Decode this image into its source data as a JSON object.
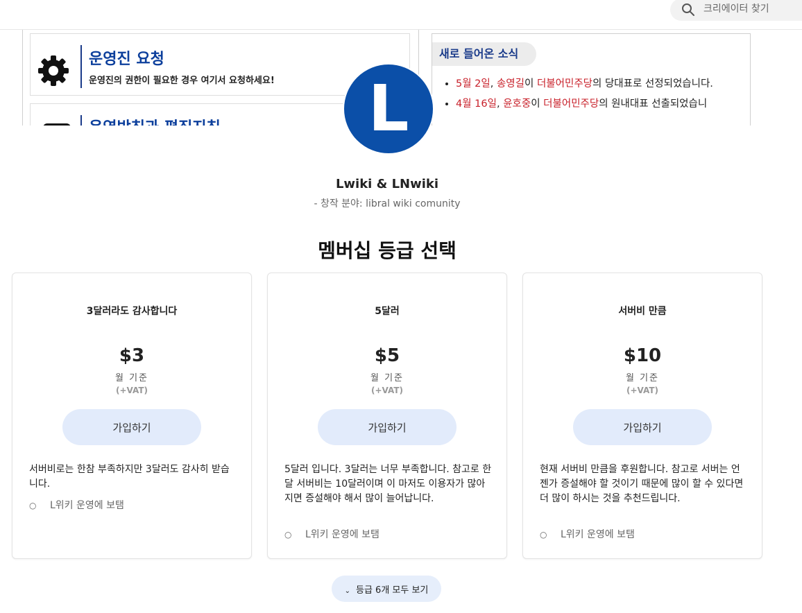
{
  "search": {
    "placeholder": "크리에이터 찾기",
    "icon": "search-icon"
  },
  "cover": {
    "card_request": {
      "title": "운영진 요청",
      "subtitle": "운영진의 권한이 필요한 경우 여기서 요청하세요!",
      "icon": "gear-icon"
    },
    "card_policy": {
      "title_partial": "운영방침과 편집지침"
    },
    "news": {
      "tab": "새로 들어온 소식",
      "items": [
        {
          "date": "5월 2일",
          "sep": ", ",
          "name": "송영길",
          "p1": "이 ",
          "party": "더불어민주당",
          "p2": "의 당대표로 선정되었습니다."
        },
        {
          "date": "4월 16일",
          "sep": ", ",
          "name": "윤호중",
          "p1": "이 ",
          "party": "더불어민주당",
          "p2": "의 원내대표 선출되었습니"
        }
      ]
    }
  },
  "creator": {
    "logo_letter": "L",
    "name": "Lwiki & LNwiki",
    "category": "- 창작 분야: libral wiki comunity"
  },
  "membership": {
    "title": "멤버십 등급 선택",
    "tiers": [
      {
        "name": "3달러라도 감사합니다",
        "price": "$3",
        "period": "월 기준",
        "vat": "(+VAT)",
        "join": "가입하기",
        "desc": "서버비로는 한참 부족하지만 3달러도 감사히 받습니다.",
        "benefit": "L위키 운영에 보탬"
      },
      {
        "name": "5달러",
        "price": "$5",
        "period": "월 기준",
        "vat": "(+VAT)",
        "join": "가입하기",
        "desc": "5달러 입니다. 3달러는 너무 부족합니다. 참고로 한달 서버비는 10달러이며 이 마저도 이용자가 많아지면 증설해야 해서 많이 늘어납니다.",
        "benefit": "L위키 운영에 보탬"
      },
      {
        "name": "서버비 만큼",
        "price": "$10",
        "period": "월 기준",
        "vat": "(+VAT)",
        "join": "가입하기",
        "desc": "현재 서버비 만큼을 후원합니다. 참고로 서버는 언젠가 증설해야 할 것이기 때문에 많이 할 수 있다면 더 많이 하시는 것을 추천드립니다.",
        "benefit": "L위키 운영에 보탬"
      }
    ],
    "see_all": "등급 6개 모두 보기"
  },
  "colors": {
    "accent_blue": "#0b4fa8",
    "join_button_bg": "#e2ebfb",
    "news_red": "#c8202a",
    "wiki_title_blue": "#0c3f9c"
  }
}
